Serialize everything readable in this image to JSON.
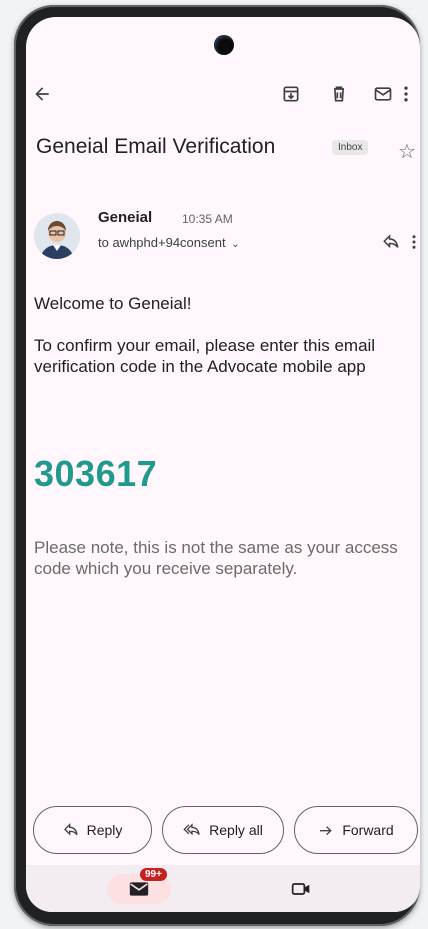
{
  "toolbar": {
    "back_icon": "arrow-back-icon",
    "archive_icon": "archive-icon",
    "delete_icon": "trash-icon",
    "mark_unread_icon": "mail-icon",
    "more_icon": "more-vert-icon"
  },
  "email": {
    "subject": "Geneial Email Verification",
    "label": "Inbox",
    "sender_name": "Geneial",
    "time": "10:35 AM",
    "to": "to awhphd+94consent",
    "greeting": "Welcome to Geneial!",
    "instruction": "To confirm your email, please enter this email verification code in the Advocate mobile app",
    "code": "303617",
    "note": "Please note, this is not the same as your access code which you receive separately."
  },
  "actions": {
    "reply": "Reply",
    "reply_all": "Reply all",
    "forward": "Forward"
  },
  "nav": {
    "mail_badge": "99+"
  },
  "colors": {
    "code": "#21998e",
    "badge": "#c5221f",
    "screen_bg": "#fff7fb"
  }
}
